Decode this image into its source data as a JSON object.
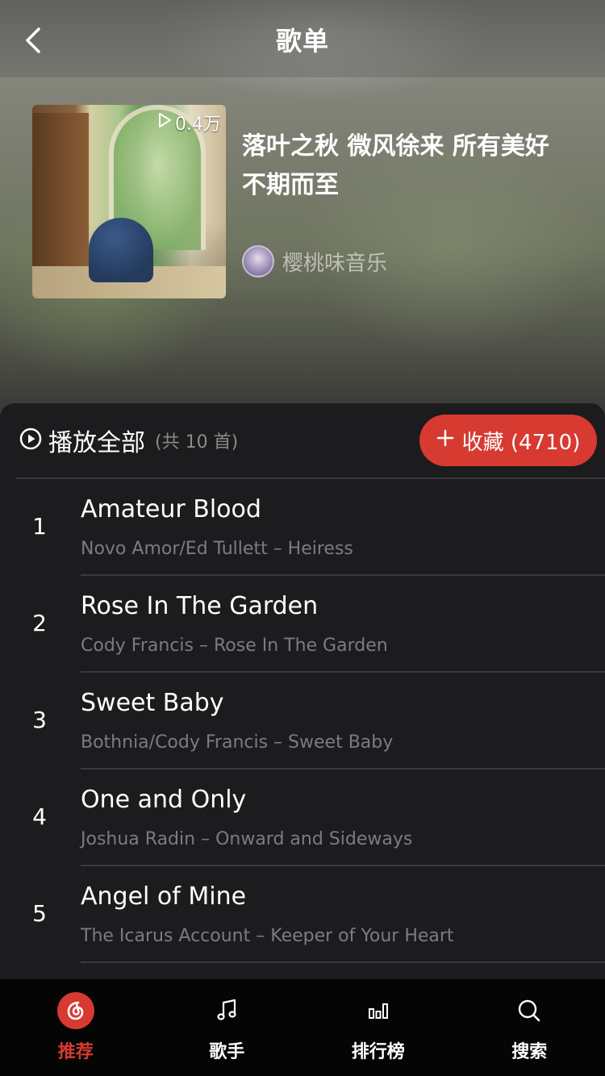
{
  "nav": {
    "title": "歌单"
  },
  "playlist": {
    "play_count": "0.4万",
    "title": "落叶之秋 微风徐来 所有美好不期而至",
    "creator": "樱桃味音乐"
  },
  "actions": {
    "play_all_label": "播放全部",
    "play_all_count": "(共 10 首)",
    "collect_label": "收藏 (4710)"
  },
  "songs": [
    {
      "index": "1",
      "name": "Amateur Blood",
      "meta": "Novo Amor/Ed Tullett – Heiress"
    },
    {
      "index": "2",
      "name": "Rose In The Garden",
      "meta": "Cody Francis – Rose In The Garden"
    },
    {
      "index": "3",
      "name": "Sweet Baby",
      "meta": "Bothnia/Cody Francis – Sweet Baby"
    },
    {
      "index": "4",
      "name": "One and Only",
      "meta": "Joshua Radin – Onward and Sideways"
    },
    {
      "index": "5",
      "name": "Angel of Mine",
      "meta": "The Icarus Account – Keeper of Your Heart"
    }
  ],
  "tabs": [
    {
      "label": "推荐",
      "icon": "netease-music-icon",
      "active": true
    },
    {
      "label": "歌手",
      "icon": "music-note-icon",
      "active": false
    },
    {
      "label": "排行榜",
      "icon": "bar-chart-icon",
      "active": false
    },
    {
      "label": "搜索",
      "icon": "search-icon",
      "active": false
    }
  ],
  "colors": {
    "accent": "#d63a31",
    "background": "#1c1b1e",
    "tabbar": "#050505"
  }
}
